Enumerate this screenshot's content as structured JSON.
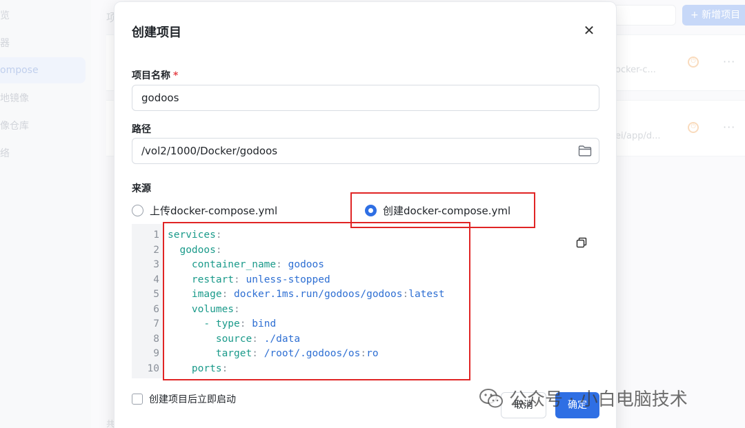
{
  "background": {
    "sidebar_items": [
      {
        "label": "览",
        "active": false
      },
      {
        "label": "器",
        "active": false
      },
      {
        "label": "ompose",
        "active": true
      },
      {
        "label": "地镜像",
        "active": false
      },
      {
        "label": "像仓库",
        "active": false
      },
      {
        "label": "络",
        "active": false
      }
    ],
    "heading": "项",
    "add_button_label": "+ 新增项目",
    "cards": [
      {
        "path": "ocker-c..."
      },
      {
        "path": "ei/app/d..."
      }
    ],
    "footer_text": "共"
  },
  "dialog": {
    "title": "创建项目",
    "name_label": "项目名称",
    "name_required_mark": "*",
    "name_value": "godoos",
    "path_label": "路径",
    "path_value": "/vol2/1000/Docker/godoos",
    "source_label": "来源",
    "source_options": [
      {
        "label": "上传docker-compose.yml",
        "selected": false
      },
      {
        "label": "创建docker-compose.yml",
        "selected": true
      }
    ],
    "code_lines": [
      {
        "n": "1",
        "indent": "",
        "key": "services",
        "sep": ":",
        "value": ""
      },
      {
        "n": "2",
        "indent": "  ",
        "key": "godoos",
        "sep": ":",
        "value": ""
      },
      {
        "n": "3",
        "indent": "    ",
        "key": "container_name",
        "sep": ": ",
        "value": "godoos"
      },
      {
        "n": "4",
        "indent": "    ",
        "key": "restart",
        "sep": ": ",
        "value": "unless-stopped"
      },
      {
        "n": "5",
        "indent": "    ",
        "key": "image",
        "sep": ": ",
        "value": "docker.1ms.run/godoos/godoos:latest"
      },
      {
        "n": "6",
        "indent": "    ",
        "key": "volumes",
        "sep": ":",
        "value": ""
      },
      {
        "n": "7",
        "indent": "      ",
        "key": "- type",
        "sep": ": ",
        "value": "bind"
      },
      {
        "n": "8",
        "indent": "        ",
        "key": "source",
        "sep": ": ",
        "value": "./data"
      },
      {
        "n": "9",
        "indent": "        ",
        "key": "target",
        "sep": ": ",
        "value": "/root/.godoos/os:ro"
      },
      {
        "n": "10",
        "indent": "    ",
        "key": "ports",
        "sep": ":",
        "value": ""
      }
    ],
    "autostart_label": "创建项目后立即启动",
    "cancel_label": "取消",
    "confirm_label": "确定"
  },
  "watermark": {
    "text": "公众号 · 小白电脑技术"
  },
  "colors": {
    "primary": "#2f6fe4",
    "annotation": "#e02424",
    "yaml_key": "#1a9a8a",
    "yaml_value": "#2e6fd3"
  }
}
